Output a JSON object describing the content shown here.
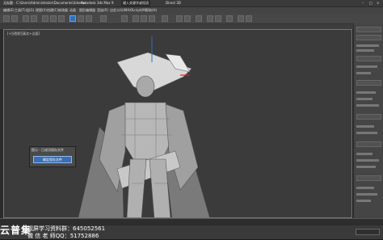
{
  "title_bar": {
    "path": "无标题 - C:\\Users\\Administrator\\Documents\\3dsmax",
    "app": "Autodesk 3ds Max 9",
    "search": "键入关键字或短语",
    "file": "Direct 3D"
  },
  "menu": {
    "items": [
      "编辑(E)",
      "工具(T)",
      "组(G)",
      "视图(V)",
      "创建(C)",
      "修改器",
      "动画",
      "图形编辑器",
      "渲染(R)",
      "自定义(U)",
      "MAXScript(M)",
      "帮助(H)"
    ]
  },
  "viewport": {
    "label": "[+][透视][真实+边面]"
  },
  "dialog": {
    "caption": "提示 - 已成功保存文件",
    "button": "确定保存文件"
  },
  "watermark": {
    "brand": "云普集",
    "line1": "视屏学习资料群：645052561",
    "line2": "微 信 老 师QQ：51752886"
  },
  "colors": {
    "accent": "#2e6fb8",
    "viewport_bg": "#3b3b3b",
    "highlight": "#e02020"
  },
  "icons": [
    "select-icon",
    "move-icon",
    "rotate-icon",
    "scale-icon",
    "snap-icon",
    "render-icon"
  ]
}
